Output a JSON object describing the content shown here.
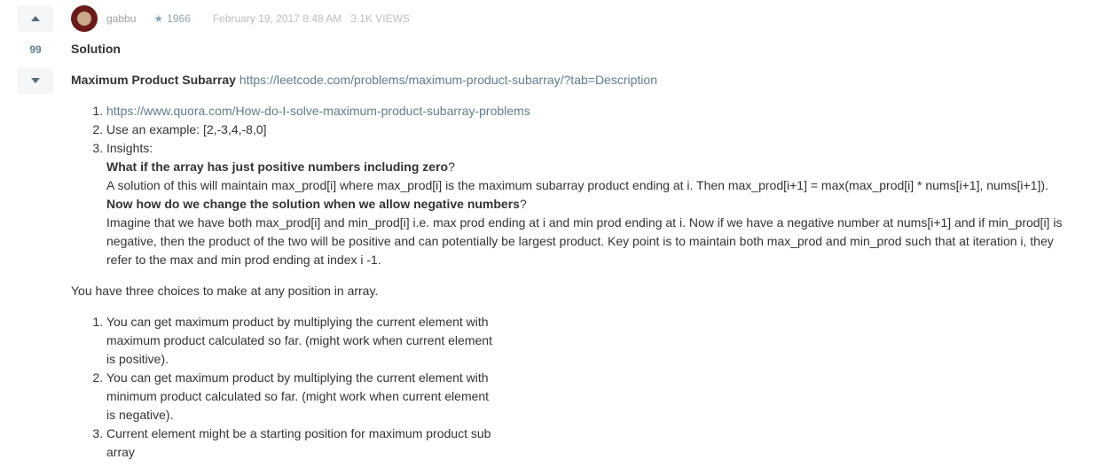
{
  "vote": {
    "count": "99"
  },
  "meta": {
    "username": "gabbu",
    "reputation": "1966",
    "date": "February 19, 2017 8:48 AM",
    "views": "3.1K VIEWS"
  },
  "post": {
    "title": "Solution",
    "problem_label": "Maximum Product Subarray",
    "problem_link": "https://leetcode.com/problems/maximum-product-subarray/?tab=Description",
    "list1": {
      "item1_link": "https://www.quora.com/How-do-I-solve-maximum-product-subarray-problems",
      "item2": "Use an example: [2,-3,4,-8,0]",
      "item3": "Insights:",
      "q1": "What if the array has just positive numbers including zero",
      "q_mark": "?",
      "a1": "A solution of this will maintain max_prod[i] where max_prod[i] is the maximum subarray product ending at i. Then max_prod[i+1] = max(max_prod[i] * nums[i+1], nums[i+1]).",
      "q2": "Now how do we change the solution when we allow negative numbers",
      "a2": "Imagine that we have both max_prod[i] and min_prod[i] i.e. max prod ending at i and min prod ending at i. Now if we have a negative number at nums[i+1] and if min_prod[i] is negative, then the product of the two will be positive and can potentially be largest product. Key point is to maintain both max_prod and min_prod such that at iteration i, they refer to the max and min prod ending at index i -1."
    },
    "choices_intro": "You have three choices to make at any position in array.",
    "choices": [
      "You can get maximum product by multiplying the current element with maximum product calculated so far. (might work when current element is positive).",
      "You can get maximum product by multiplying the current element with minimum product calculated so far. (might work when current element is negative).",
      "Current element might be a starting position for maximum product sub array"
    ]
  }
}
